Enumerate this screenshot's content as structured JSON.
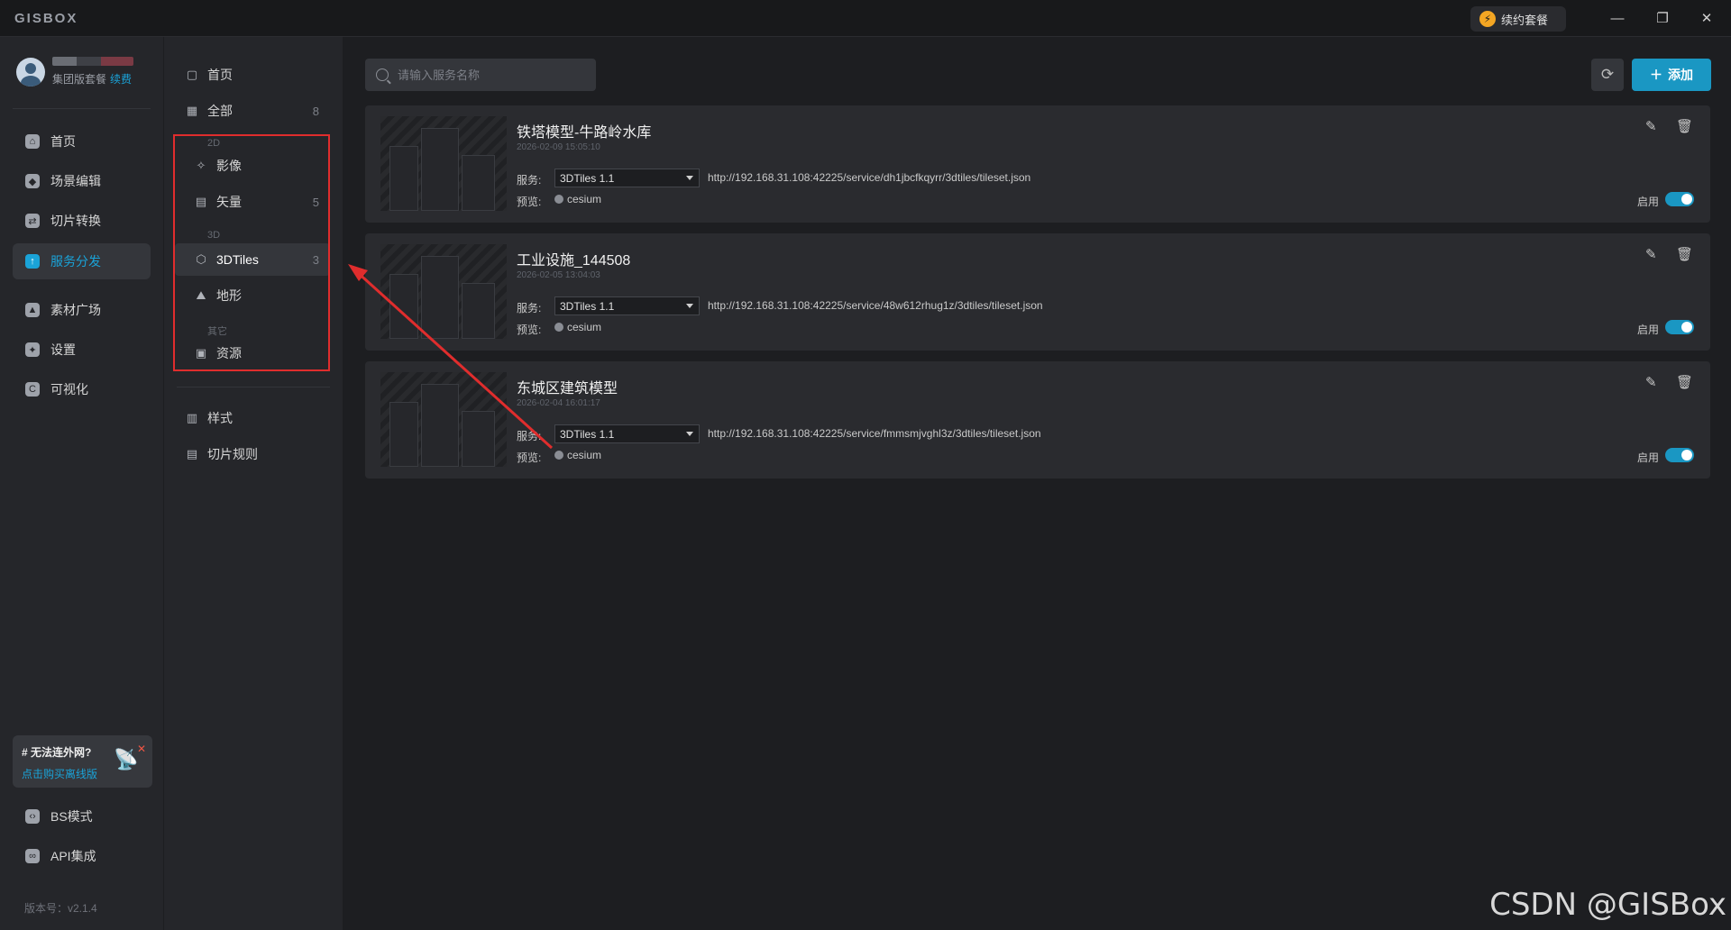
{
  "app": {
    "logo": "GISBOX",
    "renew_label": "续约套餐"
  },
  "window": {
    "minimize": "—",
    "restore": "❐",
    "close": "✕"
  },
  "user": {
    "plan": "集团版套餐",
    "renew_link": "续费"
  },
  "nav": {
    "items": [
      {
        "label": "首页",
        "icon": "home-icon"
      },
      {
        "label": "场景编辑",
        "icon": "cube-icon"
      },
      {
        "label": "切片转换",
        "icon": "convert-icon"
      },
      {
        "label": "服务分发",
        "icon": "upload-icon",
        "active": true
      },
      {
        "label": "素材广场",
        "icon": "image-icon"
      },
      {
        "label": "设置",
        "icon": "gear-icon"
      },
      {
        "label": "可视化",
        "icon": "visual-icon"
      }
    ],
    "bottom": [
      {
        "label": "BS模式",
        "icon": "code-icon"
      },
      {
        "label": "API集成",
        "icon": "link-icon"
      }
    ]
  },
  "offline": {
    "title": "# 无法连外网?",
    "link": "点击购买离线版"
  },
  "version": "版本号：v2.1.4",
  "panel": {
    "home": "首页",
    "all": {
      "label": "全部",
      "count": "8"
    },
    "group_2d": "2D",
    "imagery": "影像",
    "vector": {
      "label": "矢量",
      "count": "5"
    },
    "group_3d": "3D",
    "tiles3d": {
      "label": "3DTiles",
      "count": "3"
    },
    "terrain": "地形",
    "group_other": "其它",
    "resource": "资源",
    "style": "样式",
    "tile_rules": "切片规则"
  },
  "search": {
    "placeholder": "请输入服务名称"
  },
  "toolbar": {
    "add_label": "添加"
  },
  "cards": [
    {
      "title": "铁塔模型-牛路岭水库",
      "date": "2026-02-09 15:05:10",
      "service_label": "服务:",
      "service": "3DTiles 1.1",
      "url": "http://192.168.31.108:42225/service/dh1jbcfkqyrr/3dtiles/tileset.json",
      "preview_label": "预览:",
      "preview": "cesium",
      "enabled_label": "启用"
    },
    {
      "title": "工业设施_144508",
      "date": "2026-02-05 13:04:03",
      "service_label": "服务:",
      "service": "3DTiles 1.1",
      "url": "http://192.168.31.108:42225/service/48w612rhug1z/3dtiles/tileset.json",
      "preview_label": "预览:",
      "preview": "cesium",
      "enabled_label": "启用"
    },
    {
      "title": "东城区建筑模型",
      "date": "2026-02-04 16:01:17",
      "service_label": "服务:",
      "service": "3DTiles 1.1",
      "url": "http://192.168.31.108:42225/service/fmmsmjvghl3z/3dtiles/tileset.json",
      "preview_label": "预览:",
      "preview": "cesium",
      "enabled_label": "启用"
    }
  ],
  "watermark": "CSDN @GISBox"
}
